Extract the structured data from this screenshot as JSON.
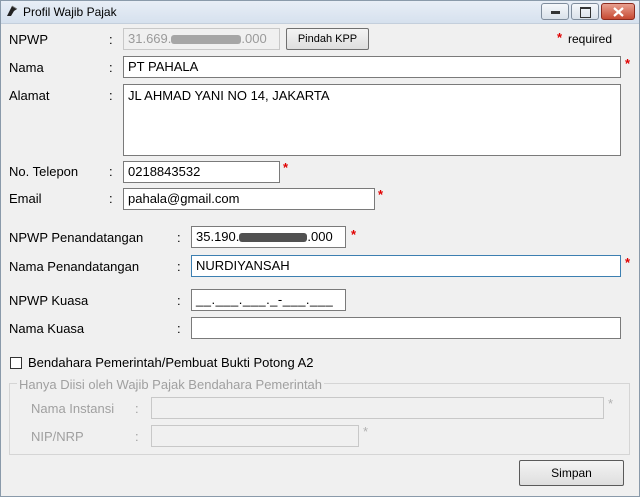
{
  "window": {
    "title": "Profil Wajib Pajak",
    "minimize_glyph": "—",
    "maximize_glyph": "□",
    "close_glyph": "✕"
  },
  "required_note": {
    "star": "*",
    "text": "required"
  },
  "npwp": {
    "label": "NPWP",
    "colon": ":",
    "value_prefix": "31.669.",
    "value_suffix": ".000",
    "button": "Pindah KPP"
  },
  "nama": {
    "label": "Nama",
    "colon": ":",
    "value": "PT PAHALA",
    "star": "*"
  },
  "alamat": {
    "label": "Alamat",
    "colon": ":",
    "value": "JL AHMAD YANI NO 14, JAKARTA"
  },
  "telepon": {
    "label": "No. Telepon",
    "colon": ":",
    "value": "0218843532",
    "star": "*"
  },
  "email": {
    "label": "Email",
    "colon": ":",
    "value": "pahala@gmail.com",
    "star": "*"
  },
  "npwp_penandatangan": {
    "label": "NPWP Penandatangan",
    "colon": ":",
    "value_prefix": "35.190.",
    "value_suffix": ".000",
    "star": "*"
  },
  "nama_penandatangan": {
    "label": "Nama Penandatangan",
    "colon": ":",
    "value": "NURDIYANSAH",
    "star": "*"
  },
  "npwp_kuasa": {
    "label": "NPWP Kuasa",
    "colon": ":",
    "value": "__.___.___._-___.___"
  },
  "nama_kuasa": {
    "label": "Nama Kuasa",
    "colon": ":",
    "value": ""
  },
  "bendahara": {
    "checkbox_label": "Bendahara Pemerintah/Pembuat Bukti Potong A2",
    "checked": false
  },
  "group": {
    "legend": "Hanya Diisi oleh Wajib Pajak Bendahara Pemerintah",
    "instansi_label": "Nama Instansi",
    "instansi_colon": ":",
    "instansi_star": "*",
    "nip_label": "NIP/NRP",
    "nip_colon": ":",
    "nip_star": "*"
  },
  "save_button": "Simpan",
  "colors": {
    "required": "#e00000",
    "focus_border": "#3c7fb1",
    "disabled_text": "#a0a0a0"
  }
}
